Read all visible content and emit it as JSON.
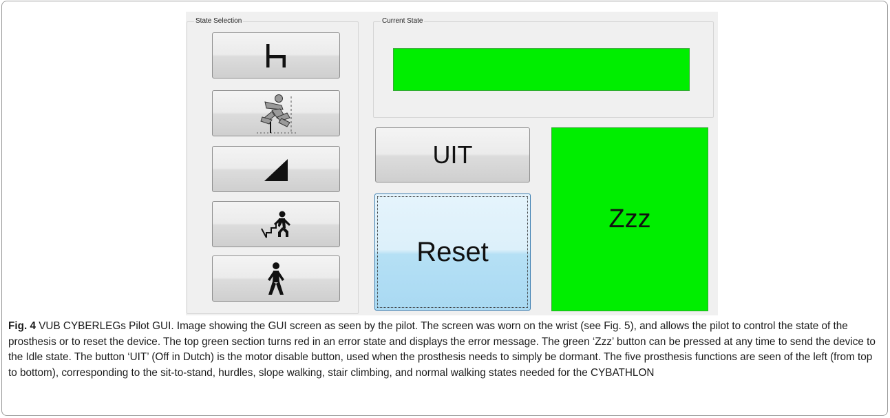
{
  "gui": {
    "state_selection": {
      "title": "State Selection",
      "buttons": [
        {
          "name": "sit-to-stand",
          "icon": "chair-icon"
        },
        {
          "name": "hurdles",
          "icon": "hurdle-jumper-icon"
        },
        {
          "name": "slope-walking",
          "icon": "slope-triangle-icon"
        },
        {
          "name": "stair-climbing",
          "icon": "stair-climber-icon"
        },
        {
          "name": "normal-walking",
          "icon": "walking-person-icon"
        }
      ]
    },
    "current_state": {
      "title": "Current State",
      "status_color": "#00ee00"
    },
    "uit_label": "UIT",
    "reset_label": "Reset",
    "zzz_label": "Zzz",
    "zzz_color": "#00ee00"
  },
  "caption": {
    "fig_label": "Fig. 4",
    "text": "VUB CYBERLEGs Pilot GUI. Image showing the GUI screen as seen by the pilot. The screen was worn on the wrist (see Fig. 5), and allows the pilot to control the state of the prosthesis or to reset the device. The top green section turns red in an error state and displays the error message. The green ‘Zzz’ button can be pressed at any time to send the device to the Idle state. The button ‘UIT’ (Off in Dutch) is the motor disable button, used when the prosthesis needs to simply be dormant. The five prosthesis functions are seen of the left (from top to bottom), corresponding to the sit-to-stand, hurdles, slope walking, stair climbing, and normal walking states needed for the CYBATHLON"
  }
}
